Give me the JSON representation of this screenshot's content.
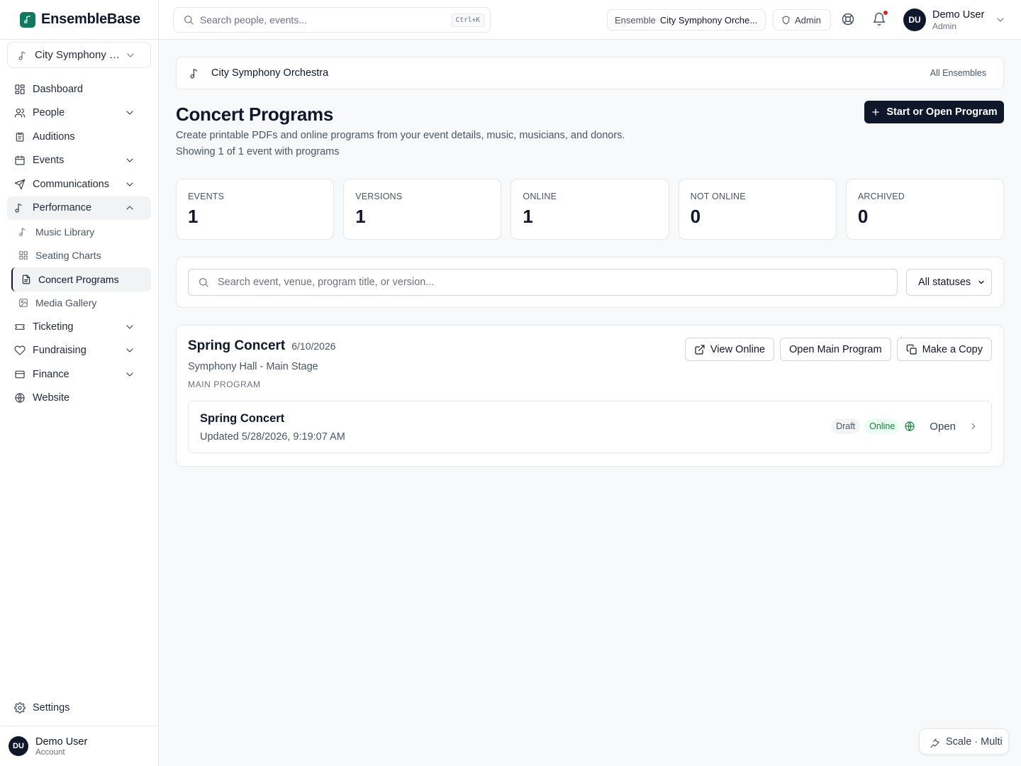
{
  "app": {
    "name": "EnsembleBase"
  },
  "sidebar": {
    "ensemble_select": "City Symphony O...",
    "items": [
      {
        "label": "Dashboard",
        "icon": "grid-icon"
      },
      {
        "label": "People",
        "icon": "users-icon"
      },
      {
        "label": "Auditions",
        "icon": "clipboard-icon"
      },
      {
        "label": "Events",
        "icon": "calendar-icon"
      },
      {
        "label": "Communications",
        "icon": "send-icon"
      },
      {
        "label": "Performance",
        "icon": "music-note-icon"
      },
      {
        "label": "Ticketing",
        "icon": "ticket-icon"
      },
      {
        "label": "Fundraising",
        "icon": "heart-icon"
      },
      {
        "label": "Finance",
        "icon": "receipt-icon"
      },
      {
        "label": "Website",
        "icon": "globe-icon"
      }
    ],
    "performance_sub": [
      {
        "label": "Music Library",
        "icon": "music-note-icon"
      },
      {
        "label": "Seating Charts",
        "icon": "grid-icon"
      },
      {
        "label": "Concert Programs",
        "icon": "file-icon"
      },
      {
        "label": "Media Gallery",
        "icon": "image-icon"
      }
    ],
    "settings": "Settings",
    "account": {
      "initials": "DU",
      "name": "Demo User",
      "sub": "Account"
    }
  },
  "topbar": {
    "search_placeholder": "Search people, events...",
    "shortcut": "Ctrl+K",
    "ensemble_label": "Ensemble",
    "ensemble_value": "City Symphony Orche...",
    "role_pill": "Admin",
    "user": {
      "initials": "DU",
      "name": "Demo User",
      "role": "Admin"
    }
  },
  "main": {
    "crumb_title": "City Symphony Orchestra",
    "crumb_link": "All Ensembles",
    "title": "Concert Programs",
    "description": "Create printable PDFs and online programs from your event details, music, musicians, and donors.",
    "count_text": "Showing 1 of 1 event with programs",
    "primary_action": "Start or Open Program",
    "stats": [
      {
        "label": "EVENTS",
        "value": "1"
      },
      {
        "label": "VERSIONS",
        "value": "1"
      },
      {
        "label": "ONLINE",
        "value": "1"
      },
      {
        "label": "NOT ONLINE",
        "value": "0"
      },
      {
        "label": "ARCHIVED",
        "value": "0"
      }
    ],
    "filter_placeholder": "Search event, venue, program title, or version...",
    "status_filter": "All statuses",
    "event": {
      "title": "Spring Concert",
      "date": "6/10/2026",
      "venue": "Symphony Hall - Main Stage",
      "section": "MAIN PROGRAM",
      "actions": {
        "view_online": "View Online",
        "open_main": "Open Main Program",
        "copy": "Make a Copy"
      },
      "version": {
        "title": "Spring Concert",
        "updated": "Updated 5/28/2026, 9:19:07 AM",
        "badges": [
          "Draft",
          "Online"
        ],
        "open": "Open"
      }
    }
  },
  "floating": {
    "label": "Scale · Multi"
  },
  "colors": {
    "brand": "#0f7a5f",
    "primary": "#0f172a",
    "online": "#15803d",
    "notify": "#dc2626"
  }
}
